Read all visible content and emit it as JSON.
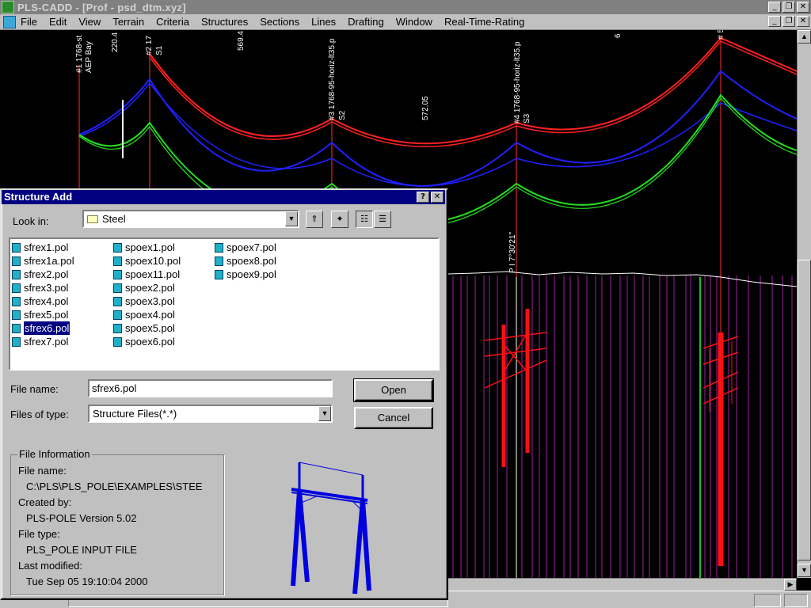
{
  "window": {
    "title": "PLS-CADD - [Prof - psd_dtm.xyz]",
    "menu": [
      "File",
      "Edit",
      "View",
      "Terrain",
      "Criteria",
      "Structures",
      "Sections",
      "Lines",
      "Drafting",
      "Window",
      "Real-Time-Rating"
    ]
  },
  "profile": {
    "span_labels": [
      "220.4",
      "569.4",
      "572.05",
      "6"
    ],
    "structure_labels": [
      "#1 1768-st",
      "AEP Bay",
      "#2 17",
      "S1",
      "#3 1768-95-horiz-lt35.p",
      "S2",
      "#4 1768-95-horiz-lt35.p",
      "S3",
      "# 5"
    ],
    "pi_label": "P I 7°30'21\"",
    "colors": {
      "red": "#ff2020",
      "blue": "#2020ff",
      "green": "#20e020",
      "terrain": "#ffffff",
      "grid": "#a020a0"
    }
  },
  "dialog": {
    "title": "Structure Add",
    "look_in_label": "Look in:",
    "look_in_value": "Steel",
    "files": {
      "col1": [
        "sfrex1.pol",
        "sfrex1a.pol",
        "sfrex2.pol",
        "sfrex3.pol",
        "sfrex4.pol",
        "sfrex5.pol",
        "sfrex6.pol",
        "sfrex7.pol"
      ],
      "col2": [
        "spoex1.pol",
        "spoex10.pol",
        "spoex11.pol",
        "spoex2.pol",
        "spoex3.pol",
        "spoex4.pol",
        "spoex5.pol",
        "spoex6.pol"
      ],
      "col3": [
        "spoex7.pol",
        "spoex8.pol",
        "spoex9.pol"
      ]
    },
    "file_name_label": "File name:",
    "file_name_value": "sfrex6.pol",
    "files_of_type_label": "Files of type:",
    "files_of_type_value": "Structure Files(*.*)",
    "open_label": "Open",
    "cancel_label": "Cancel",
    "info": {
      "group_title": "File Information",
      "file_name_label": "File name:",
      "file_name_value": "C:\\PLS\\PLS_POLE\\EXAMPLES\\STEE",
      "created_by_label": "Created by:",
      "created_by_value": "PLS-POLE Version 5.02",
      "file_type_label": "File type:",
      "file_type_value": "PLS_POLE INPUT FILE",
      "modified_label": "Last modified:",
      "modified_value": "Tue Sep 05 19:10:04 2000"
    }
  }
}
